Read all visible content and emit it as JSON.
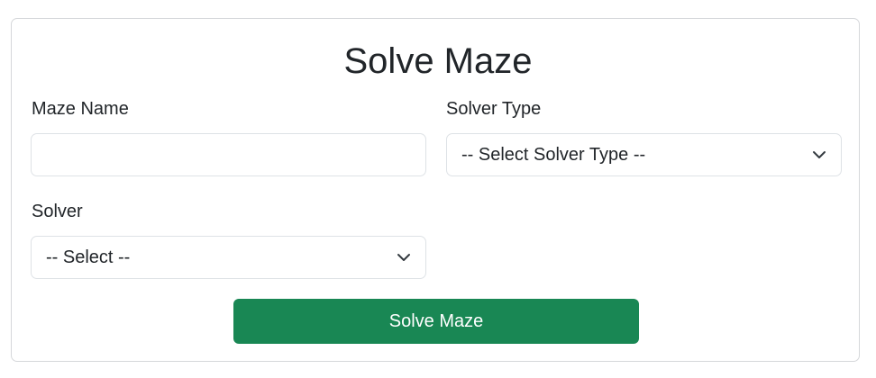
{
  "form": {
    "title": "Solve Maze",
    "maze_name": {
      "label": "Maze Name",
      "value": "",
      "placeholder": ""
    },
    "solver_type": {
      "label": "Solver Type",
      "selected": "-- Select Solver Type --"
    },
    "solver": {
      "label": "Solver",
      "selected": "-- Select --"
    },
    "submit_label": "Solve Maze"
  },
  "colors": {
    "primary_button": "#198754",
    "border": "#dee2e6",
    "text": "#212529"
  },
  "icons": {
    "select_chevron": "chevron-down-icon"
  }
}
